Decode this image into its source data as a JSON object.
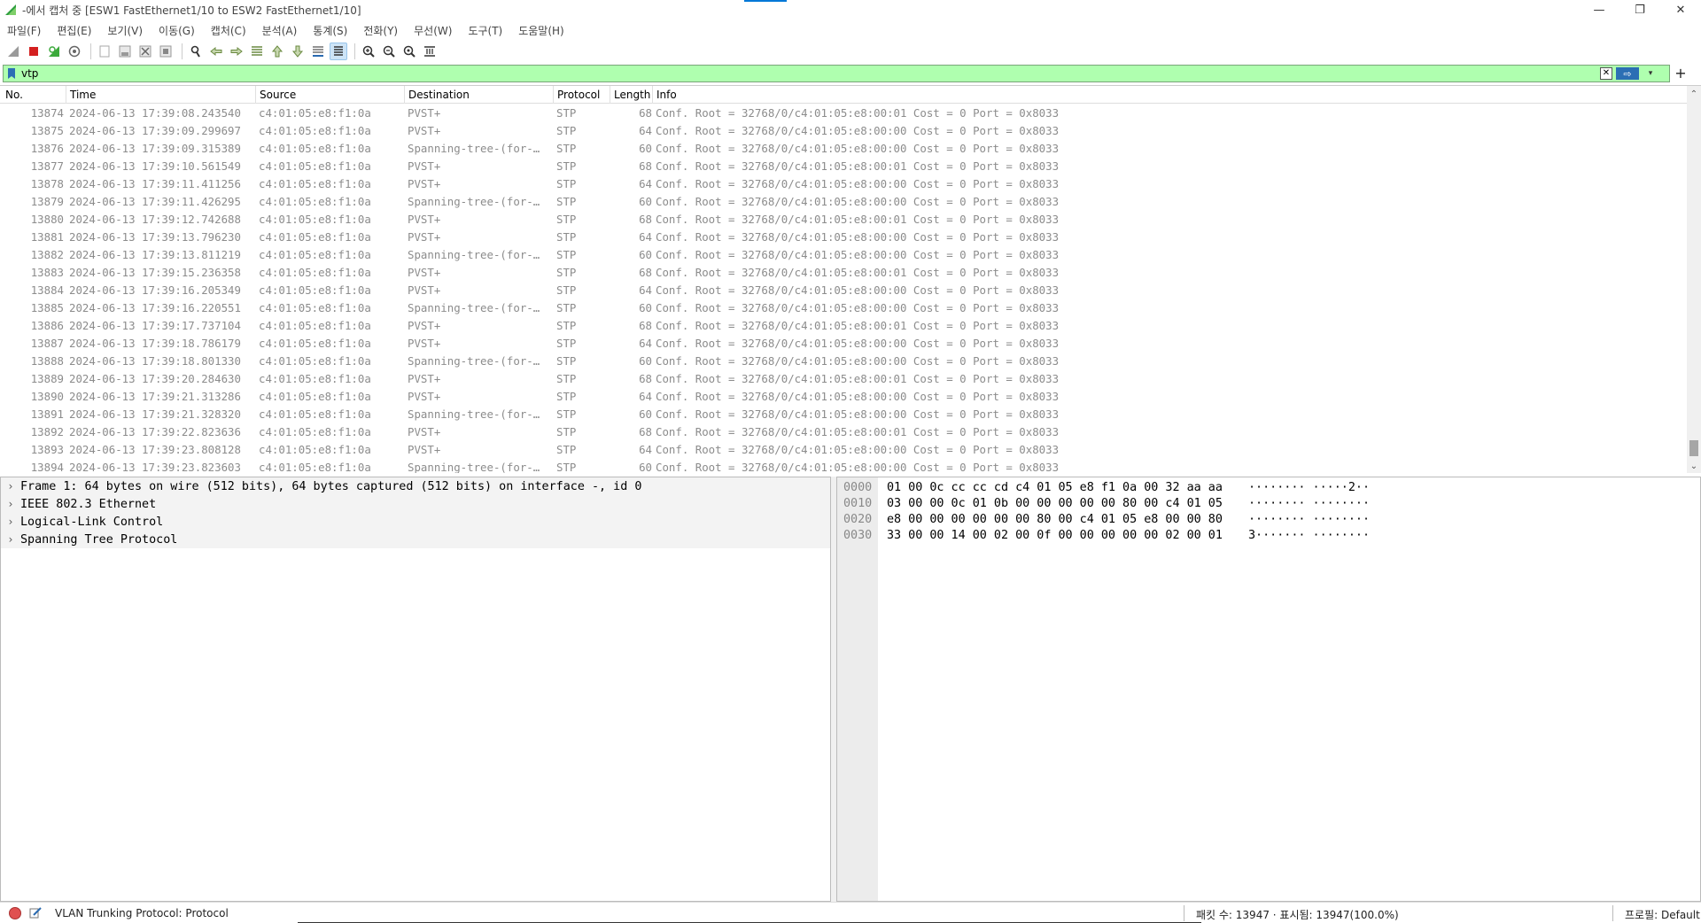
{
  "window": {
    "title": "-에서 캡처 중 [ESW1 FastEthernet1/10 to ESW2 FastEthernet1/10]",
    "minimize_glyph": "—",
    "maximize_glyph": "❐",
    "close_glyph": "✕"
  },
  "menu": {
    "items": [
      "파일(F)",
      "편집(E)",
      "보기(V)",
      "이동(G)",
      "캡처(C)",
      "분석(A)",
      "통계(S)",
      "전화(Y)",
      "무선(W)",
      "도구(T)",
      "도움말(H)"
    ]
  },
  "toolbar": {
    "icons": [
      "shark-fin-start-icon",
      "stop-capture-icon",
      "restart-capture-icon",
      "capture-options-icon",
      "open-file-icon",
      "save-file-icon",
      "close-file-icon",
      "reload-file-icon",
      "find-packet-icon",
      "go-back-icon",
      "go-forward-icon",
      "go-to-packet-icon",
      "go-first-icon",
      "go-last-icon",
      "autoscroll-icon",
      "colorize-icon",
      "zoom-in-icon",
      "zoom-out-icon",
      "zoom-reset-icon",
      "resize-columns-icon"
    ]
  },
  "filter": {
    "value": "vtp",
    "background_color": "#afffaf",
    "apply_glyph": "⇨",
    "clear_glyph": "✕",
    "dropdown_glyph": "▾",
    "add_glyph": "+"
  },
  "packet_list": {
    "columns": [
      "No.",
      "Time",
      "Source",
      "Destination",
      "Protocol",
      "Length",
      "Info"
    ],
    "rows": [
      [
        "13874",
        "2024-06-13 17:39:08.243540",
        "c4:01:05:e8:f1:0a",
        "PVST+",
        "STP",
        "68",
        "Conf. Root = 32768/0/c4:01:05:e8:00:01  Cost = 0  Port = 0x8033"
      ],
      [
        "13875",
        "2024-06-13 17:39:09.299697",
        "c4:01:05:e8:f1:0a",
        "PVST+",
        "STP",
        "64",
        "Conf. Root = 32768/0/c4:01:05:e8:00:00  Cost = 0  Port = 0x8033"
      ],
      [
        "13876",
        "2024-06-13 17:39:09.315389",
        "c4:01:05:e8:f1:0a",
        "Spanning-tree-(for-…",
        "STP",
        "60",
        "Conf. Root = 32768/0/c4:01:05:e8:00:00  Cost = 0  Port = 0x8033"
      ],
      [
        "13877",
        "2024-06-13 17:39:10.561549",
        "c4:01:05:e8:f1:0a",
        "PVST+",
        "STP",
        "68",
        "Conf. Root = 32768/0/c4:01:05:e8:00:01  Cost = 0  Port = 0x8033"
      ],
      [
        "13878",
        "2024-06-13 17:39:11.411256",
        "c4:01:05:e8:f1:0a",
        "PVST+",
        "STP",
        "64",
        "Conf. Root = 32768/0/c4:01:05:e8:00:00  Cost = 0  Port = 0x8033"
      ],
      [
        "13879",
        "2024-06-13 17:39:11.426295",
        "c4:01:05:e8:f1:0a",
        "Spanning-tree-(for-…",
        "STP",
        "60",
        "Conf. Root = 32768/0/c4:01:05:e8:00:00  Cost = 0  Port = 0x8033"
      ],
      [
        "13880",
        "2024-06-13 17:39:12.742688",
        "c4:01:05:e8:f1:0a",
        "PVST+",
        "STP",
        "68",
        "Conf. Root = 32768/0/c4:01:05:e8:00:01  Cost = 0  Port = 0x8033"
      ],
      [
        "13881",
        "2024-06-13 17:39:13.796230",
        "c4:01:05:e8:f1:0a",
        "PVST+",
        "STP",
        "64",
        "Conf. Root = 32768/0/c4:01:05:e8:00:00  Cost = 0  Port = 0x8033"
      ],
      [
        "13882",
        "2024-06-13 17:39:13.811219",
        "c4:01:05:e8:f1:0a",
        "Spanning-tree-(for-…",
        "STP",
        "60",
        "Conf. Root = 32768/0/c4:01:05:e8:00:00  Cost = 0  Port = 0x8033"
      ],
      [
        "13883",
        "2024-06-13 17:39:15.236358",
        "c4:01:05:e8:f1:0a",
        "PVST+",
        "STP",
        "68",
        "Conf. Root = 32768/0/c4:01:05:e8:00:01  Cost = 0  Port = 0x8033"
      ],
      [
        "13884",
        "2024-06-13 17:39:16.205349",
        "c4:01:05:e8:f1:0a",
        "PVST+",
        "STP",
        "64",
        "Conf. Root = 32768/0/c4:01:05:e8:00:00  Cost = 0  Port = 0x8033"
      ],
      [
        "13885",
        "2024-06-13 17:39:16.220551",
        "c4:01:05:e8:f1:0a",
        "Spanning-tree-(for-…",
        "STP",
        "60",
        "Conf. Root = 32768/0/c4:01:05:e8:00:00  Cost = 0  Port = 0x8033"
      ],
      [
        "13886",
        "2024-06-13 17:39:17.737104",
        "c4:01:05:e8:f1:0a",
        "PVST+",
        "STP",
        "68",
        "Conf. Root = 32768/0/c4:01:05:e8:00:01  Cost = 0  Port = 0x8033"
      ],
      [
        "13887",
        "2024-06-13 17:39:18.786179",
        "c4:01:05:e8:f1:0a",
        "PVST+",
        "STP",
        "64",
        "Conf. Root = 32768/0/c4:01:05:e8:00:00  Cost = 0  Port = 0x8033"
      ],
      [
        "13888",
        "2024-06-13 17:39:18.801330",
        "c4:01:05:e8:f1:0a",
        "Spanning-tree-(for-…",
        "STP",
        "60",
        "Conf. Root = 32768/0/c4:01:05:e8:00:00  Cost = 0  Port = 0x8033"
      ],
      [
        "13889",
        "2024-06-13 17:39:20.284630",
        "c4:01:05:e8:f1:0a",
        "PVST+",
        "STP",
        "68",
        "Conf. Root = 32768/0/c4:01:05:e8:00:01  Cost = 0  Port = 0x8033"
      ],
      [
        "13890",
        "2024-06-13 17:39:21.313286",
        "c4:01:05:e8:f1:0a",
        "PVST+",
        "STP",
        "64",
        "Conf. Root = 32768/0/c4:01:05:e8:00:00  Cost = 0  Port = 0x8033"
      ],
      [
        "13891",
        "2024-06-13 17:39:21.328320",
        "c4:01:05:e8:f1:0a",
        "Spanning-tree-(for-…",
        "STP",
        "60",
        "Conf. Root = 32768/0/c4:01:05:e8:00:00  Cost = 0  Port = 0x8033"
      ],
      [
        "13892",
        "2024-06-13 17:39:22.823636",
        "c4:01:05:e8:f1:0a",
        "PVST+",
        "STP",
        "68",
        "Conf. Root = 32768/0/c4:01:05:e8:00:01  Cost = 0  Port = 0x8033"
      ],
      [
        "13893",
        "2024-06-13 17:39:23.808128",
        "c4:01:05:e8:f1:0a",
        "PVST+",
        "STP",
        "64",
        "Conf. Root = 32768/0/c4:01:05:e8:00:00  Cost = 0  Port = 0x8033"
      ],
      [
        "13894",
        "2024-06-13 17:39:23.823603",
        "c4:01:05:e8:f1:0a",
        "Spanning-tree-(for-…",
        "STP",
        "60",
        "Conf. Root = 32768/0/c4:01:05:e8:00:00  Cost = 0  Port = 0x8033"
      ]
    ],
    "row_text_color": "#8c8c8c",
    "scroll_up_glyph": "⌃",
    "scroll_down_glyph": "⌄"
  },
  "detail": {
    "items": [
      "Frame 1: 64 bytes on wire (512 bits), 64 bytes captured (512 bits) on interface -, id 0",
      "IEEE 802.3 Ethernet",
      "Logical-Link Control",
      "Spanning Tree Protocol"
    ],
    "expand_glyph": "›"
  },
  "bytes": {
    "lines": [
      {
        "offset": "0000",
        "hex": "01 00 0c cc cc cd c4 01  05 e8 f1 0a 00 32 aa aa",
        "ascii": "········ ·····2··"
      },
      {
        "offset": "0010",
        "hex": "03 00 00 0c 01 0b 00 00  00 00 00 80 00 c4 01 05",
        "ascii": "········ ········"
      },
      {
        "offset": "0020",
        "hex": "e8 00 00 00 00 00 00 80  00 c4 01 05 e8 00 00 80",
        "ascii": "········ ········"
      },
      {
        "offset": "0030",
        "hex": "33 00 00 14 00 02 00 0f  00 00 00 00 00 02 00 01",
        "ascii": "3······· ········"
      }
    ]
  },
  "status": {
    "message": "VLAN Trunking Protocol: Protocol",
    "counts": "패킷 수: 13947 · 표시됨: 13947(100.0%)",
    "profile": "프로필: Default"
  }
}
